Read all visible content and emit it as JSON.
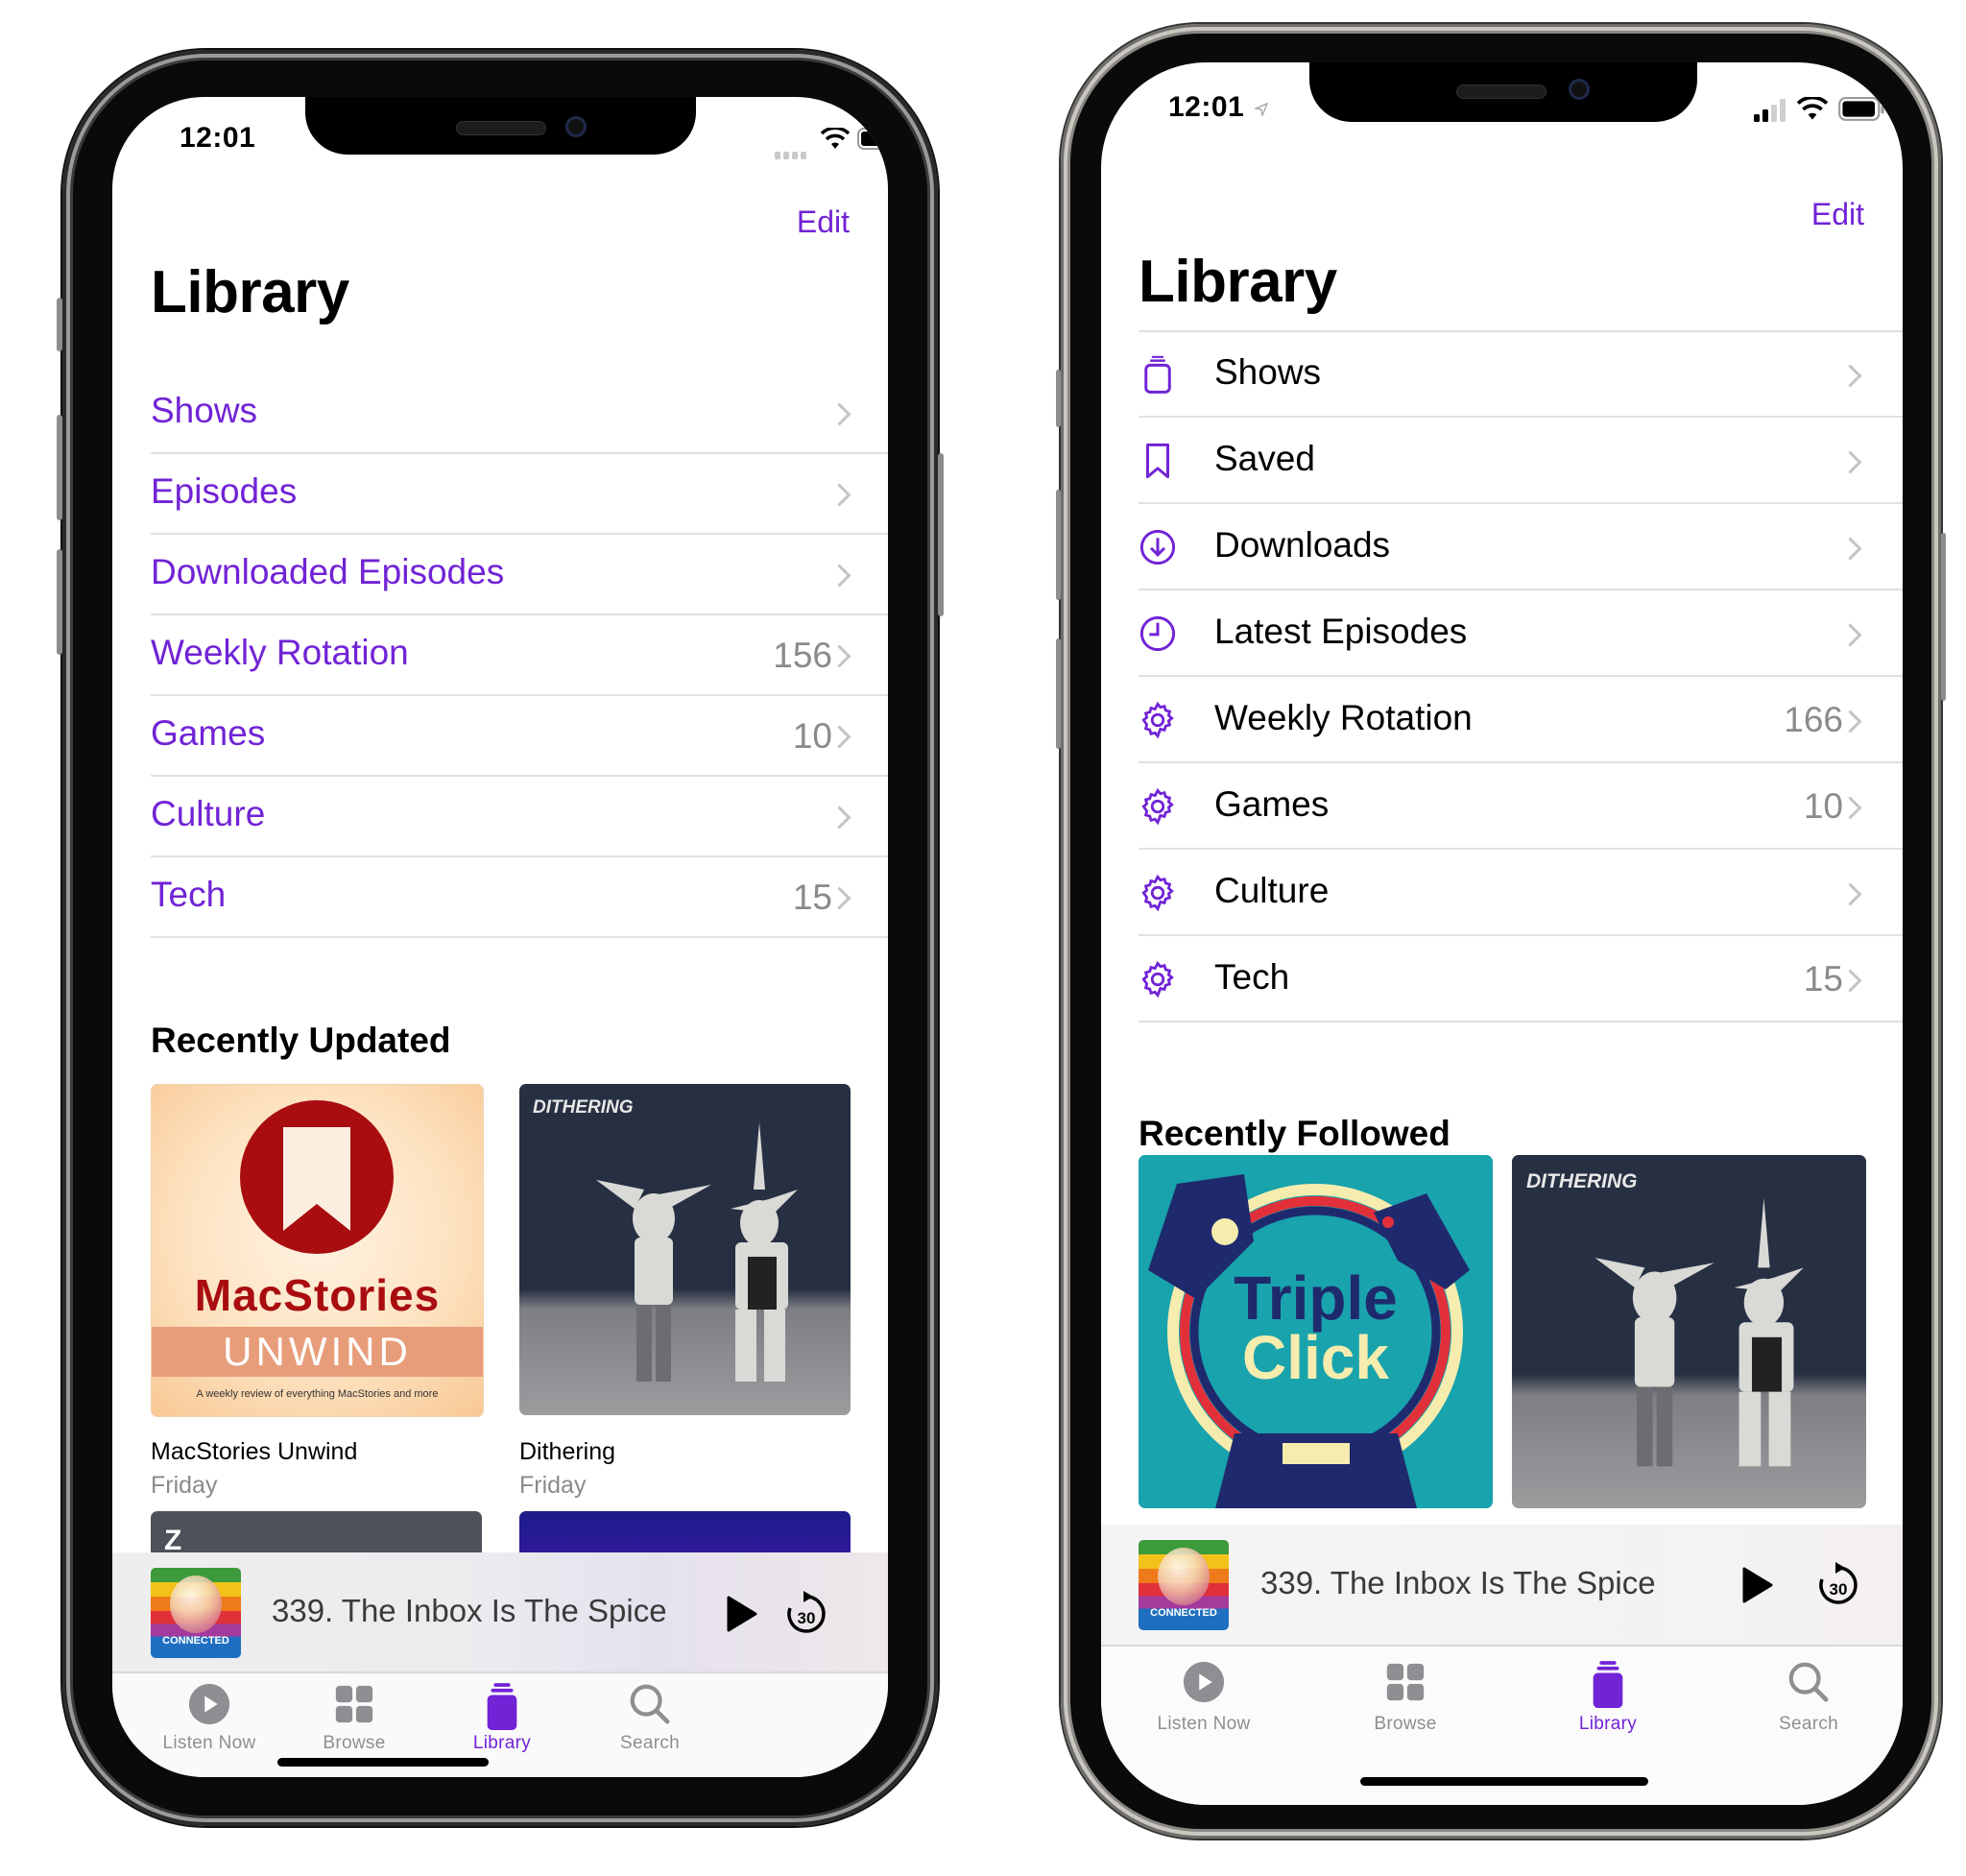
{
  "colors": {
    "accent": "#7123d6",
    "secondary_text": "#8a8a8e",
    "chevron": "#c4c4c7"
  },
  "left_phone": {
    "status": {
      "time": "12:01",
      "icons": [
        "signal-dots-icon",
        "wifi-icon",
        "battery-icon"
      ]
    },
    "nav": {
      "edit_label": "Edit",
      "title": "Library"
    },
    "list": [
      {
        "label": "Shows",
        "count": ""
      },
      {
        "label": "Episodes",
        "count": ""
      },
      {
        "label": "Downloaded Episodes",
        "count": ""
      },
      {
        "label": "Weekly Rotation",
        "count": "156"
      },
      {
        "label": "Games",
        "count": "10"
      },
      {
        "label": "Culture",
        "count": ""
      },
      {
        "label": "Tech",
        "count": "15"
      }
    ],
    "section_title": "Recently Updated",
    "shows": [
      {
        "title": "MacStories Unwind",
        "subtitle": "Friday",
        "art_title": "MacStories",
        "art_band": "UNWIND",
        "art_tagline": "A weekly review of everything MacStories and more"
      },
      {
        "title": "Dithering",
        "subtitle": "Friday",
        "art_title": "DITHERING"
      }
    ],
    "mini_player": {
      "episode": "339. The Inbox Is The Spice",
      "art_label": "CONNECTED",
      "skip_label": "30"
    },
    "tabs": [
      {
        "label": "Listen Now",
        "icon": "play-circle-icon",
        "active": false
      },
      {
        "label": "Browse",
        "icon": "grid-icon",
        "active": false
      },
      {
        "label": "Library",
        "icon": "library-stack-icon",
        "active": true
      },
      {
        "label": "Search",
        "icon": "search-icon",
        "active": false
      }
    ]
  },
  "right_phone": {
    "status": {
      "time": "12:01",
      "icons": [
        "location-arrow-icon",
        "cellular-bars-icon",
        "wifi-icon",
        "battery-icon"
      ]
    },
    "nav": {
      "edit_label": "Edit",
      "title": "Library"
    },
    "list": [
      {
        "label": "Shows",
        "icon": "shows-stack-icon",
        "count": ""
      },
      {
        "label": "Saved",
        "icon": "bookmark-icon",
        "count": ""
      },
      {
        "label": "Downloads",
        "icon": "download-circle-icon",
        "count": ""
      },
      {
        "label": "Latest Episodes",
        "icon": "clock-icon",
        "count": ""
      },
      {
        "label": "Weekly Rotation",
        "icon": "gear-icon",
        "count": "166"
      },
      {
        "label": "Games",
        "icon": "gear-icon",
        "count": "10"
      },
      {
        "label": "Culture",
        "icon": "gear-icon",
        "count": ""
      },
      {
        "label": "Tech",
        "icon": "gear-icon",
        "count": "15"
      }
    ],
    "section_title": "Recently Followed",
    "shows": [
      {
        "art_title_line1": "Triple",
        "art_title_line2": "Click"
      },
      {
        "art_title": "DITHERING"
      }
    ],
    "mini_player": {
      "episode": "339. The Inbox Is The Spice",
      "art_label": "CONNECTED",
      "skip_label": "30"
    },
    "tabs": [
      {
        "label": "Listen Now",
        "icon": "play-circle-icon",
        "active": false
      },
      {
        "label": "Browse",
        "icon": "grid-icon",
        "active": false
      },
      {
        "label": "Library",
        "icon": "library-stack-icon",
        "active": true
      },
      {
        "label": "Search",
        "icon": "search-icon",
        "active": false
      }
    ]
  }
}
